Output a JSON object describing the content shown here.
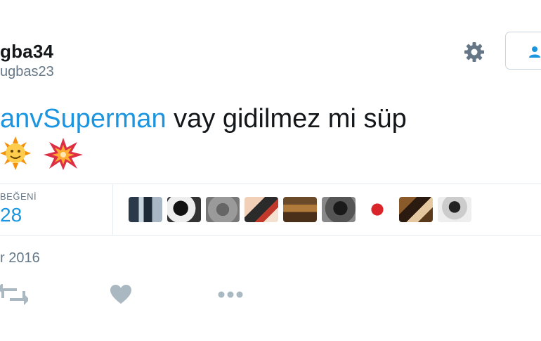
{
  "header": {
    "display_name": "gba34",
    "handle": "ugbas23",
    "settings_icon": "gear-icon",
    "follow_icon": "user-follow-icon"
  },
  "tweet": {
    "hashtag": "anvSuperman",
    "text": " vay gidilmez mi süp",
    "emojis": [
      "sun-with-face-emoji",
      "collision-emoji"
    ]
  },
  "stats": {
    "label": "BEĞENİ",
    "count": "28",
    "liker_avatars": 9
  },
  "meta": {
    "date": "r 2016"
  },
  "actions": {
    "retweet_icon": "retweet-icon",
    "like_icon": "heart-icon",
    "more_icon": "more-dots-icon"
  },
  "colors": {
    "link": "#1b95e0",
    "muted": "#657786",
    "border": "#e6ecf0"
  }
}
